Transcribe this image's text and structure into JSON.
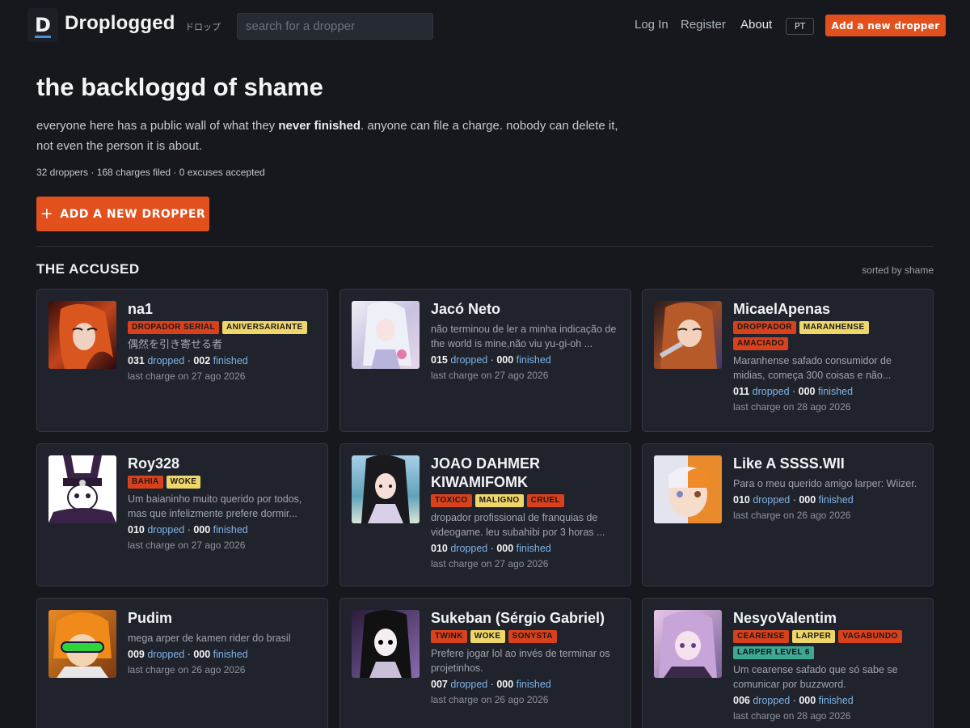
{
  "nav": {
    "logo_letter": "D",
    "brand": "Droplogged",
    "brand_kana": "ドロップ",
    "search_placeholder": "search for a dropper",
    "login": "Log In",
    "register": "Register",
    "about": "About",
    "lang": "PT",
    "cta": "Add a new dropper"
  },
  "hero": {
    "title": "the backloggd of shame",
    "desc_before": "everyone here has a public wall of what they ",
    "desc_bold": "never finished",
    "desc_after": ". anyone can file a charge. nobody can delete it, not even the person it is about.",
    "stats": "32 droppers · 168 charges filed · 0 excuses accepted",
    "button": "ADD A NEW DROPPER"
  },
  "section": {
    "title": "THE ACCUSED",
    "sort": "sorted by shame"
  },
  "labels": {
    "dropped": "dropped",
    "finished": "finished",
    "sep": " · "
  },
  "cards": [
    {
      "name": "na1",
      "tags": [
        {
          "text": "DROPADOR SERIAL",
          "color": "red"
        },
        {
          "text": "ANIVERSARIANTE",
          "color": "yellow"
        }
      ],
      "desc": "偶然を引き寄せる者",
      "dropped": "031",
      "finished": "002",
      "last": "last charge on 27 ago 2026"
    },
    {
      "name": "Jacó Neto",
      "tags": [],
      "desc": "não terminou de ler a minha indicação de the world is mine,não viu yu-gi-oh ...",
      "dropped": "015",
      "finished": "000",
      "last": "last charge on 27 ago 2026"
    },
    {
      "name": "MicaelApenas",
      "tags": [
        {
          "text": "DROPPADOR",
          "color": "red"
        },
        {
          "text": "MARANHENSE",
          "color": "yellow"
        },
        {
          "text": "AMACIADO",
          "color": "red"
        }
      ],
      "desc": "Maranhense safado consumidor de midias, começa 300 coisas e não...",
      "dropped": "011",
      "finished": "000",
      "last": "last charge on 28 ago 2026"
    },
    {
      "name": "Roy328",
      "tags": [
        {
          "text": "BAHIA",
          "color": "red"
        },
        {
          "text": "WOKE",
          "color": "yellow"
        }
      ],
      "desc": "Um baianinho muito querido por todos, mas que infelizmente prefere dormir...",
      "dropped": "010",
      "finished": "000",
      "last": "last charge on 27 ago 2026"
    },
    {
      "name": "JOAO DAHMER KIWAMIFOMK",
      "tags": [
        {
          "text": "TOXICO",
          "color": "red"
        },
        {
          "text": "MALIGNO",
          "color": "yellow"
        },
        {
          "text": "CRUEL",
          "color": "red"
        }
      ],
      "desc": "dropador profissional de franquias de videogame. leu subahibi por 3 horas ...",
      "dropped": "010",
      "finished": "000",
      "last": "last charge on 27 ago 2026"
    },
    {
      "name": "Like A SSSS.WII",
      "tags": [],
      "desc": "Para o meu querido amigo larper: Wiizer.",
      "dropped": "010",
      "finished": "000",
      "last": "last charge on 26 ago 2026"
    },
    {
      "name": "Pudim",
      "tags": [],
      "desc": "mega arper de kamen rider do brasil",
      "dropped": "009",
      "finished": "000",
      "last": "last charge on 26 ago 2026"
    },
    {
      "name": "Sukeban (Sérgio Gabriel)",
      "tags": [
        {
          "text": "TWINK",
          "color": "red"
        },
        {
          "text": "WOKE",
          "color": "yellow"
        },
        {
          "text": "SONYSTA",
          "color": "red"
        }
      ],
      "desc": "Prefere jogar lol ao invés de terminar os projetinhos.",
      "dropped": "007",
      "finished": "000",
      "last": "last charge on 26 ago 2026"
    },
    {
      "name": "NesyoValentim",
      "tags": [
        {
          "text": "CEARENSE",
          "color": "red"
        },
        {
          "text": "LARPER",
          "color": "yellow"
        },
        {
          "text": "VAGABUNDO",
          "color": "red"
        },
        {
          "text": "LARPER LEVEL 6",
          "color": "teal"
        }
      ],
      "desc": "Um cearense safado que só sabe se comunicar por buzzword.",
      "dropped": "006",
      "finished": "000",
      "last": "last charge on 28 ago 2026"
    }
  ]
}
